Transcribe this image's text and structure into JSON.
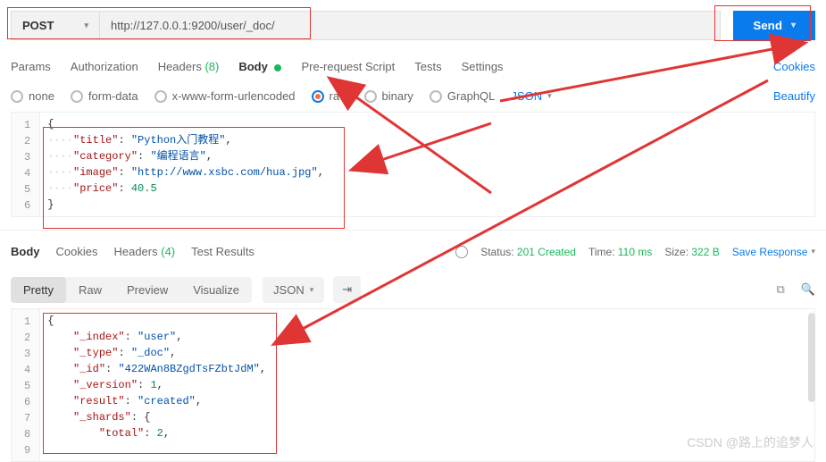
{
  "request": {
    "method": "POST",
    "url": "http://127.0.0.1:9200/user/_doc/",
    "send_label": "Send"
  },
  "tabs": {
    "params": "Params",
    "auth": "Authorization",
    "headers": "Headers",
    "headers_count": "(8)",
    "body": "Body",
    "prereq": "Pre-request Script",
    "tests": "Tests",
    "settings": "Settings",
    "cookies": "Cookies"
  },
  "body_type": {
    "none": "none",
    "formdata": "form-data",
    "urlenc": "x-www-form-urlencoded",
    "raw": "raw",
    "binary": "binary",
    "graphql": "GraphQL",
    "json": "JSON",
    "beautify": "Beautify"
  },
  "req_body": {
    "l1": "{",
    "l2_k": "\"title\"",
    "l2_v": "\"Python入门教程\"",
    "l3_k": "\"category\"",
    "l3_v": "\"编程语言\"",
    "l4_k": "\"image\"",
    "l4_v": "\"http://www.xsbc.com/hua.jpg\"",
    "l5_k": "\"price\"",
    "l5_v": "40.5",
    "l6": "}"
  },
  "resp_tabs": {
    "body": "Body",
    "cookies": "Cookies",
    "headers": "Headers",
    "headers_count": "(4)",
    "test_results": "Test Results"
  },
  "status": {
    "label": "Status:",
    "value": "201 Created",
    "time_label": "Time:",
    "time_value": "110 ms",
    "size_label": "Size:",
    "size_value": "322 B",
    "save": "Save Response"
  },
  "view": {
    "pretty": "Pretty",
    "raw": "Raw",
    "preview": "Preview",
    "visualize": "Visualize",
    "json": "JSON"
  },
  "resp_body": {
    "l1": "{",
    "l2_k": "\"_index\"",
    "l2_v": "\"user\"",
    "l3_k": "\"_type\"",
    "l3_v": "\"_doc\"",
    "l4_k": "\"_id\"",
    "l4_v": "\"422WAn8BZgdTsFZbtJdM\"",
    "l5_k": "\"_version\"",
    "l5_v": "1",
    "l6_k": "\"result\"",
    "l6_v": "\"created\"",
    "l7_k": "\"_shards\"",
    "l7_v": "{",
    "l8_k": "\"total\"",
    "l8_v": "2"
  },
  "watermark": "CSDN @路上的追梦人"
}
